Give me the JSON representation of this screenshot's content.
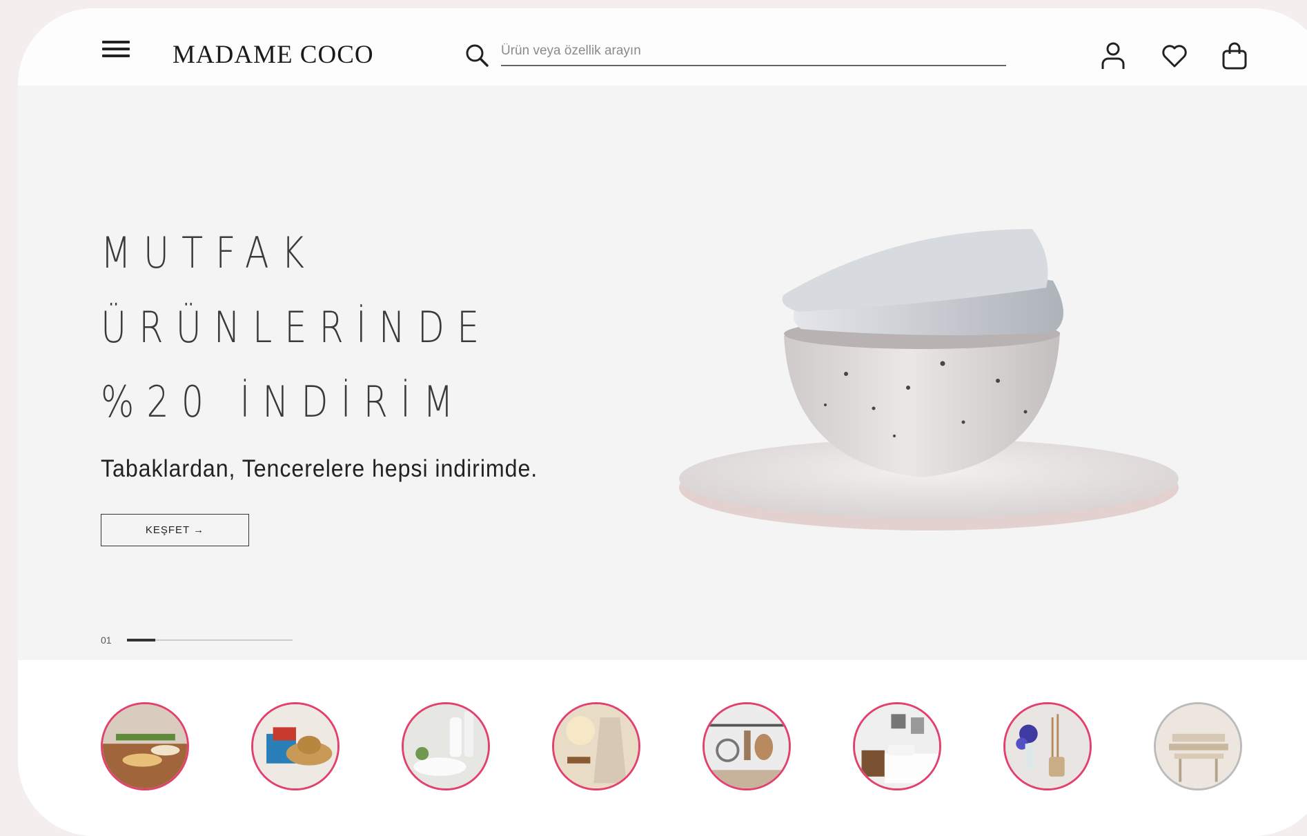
{
  "header": {
    "logo": "MADAME COCO",
    "search_placeholder": "Ürün veya özellik arayın",
    "icons": [
      "menu-icon",
      "search-icon",
      "user-icon",
      "heart-icon",
      "bag-icon"
    ]
  },
  "hero": {
    "title_lines": [
      "MUTFAK",
      "ÜRÜNLERİNDE",
      "%20 İNDİRİM"
    ],
    "subtitle": "Tabaklardan, Tencerelere hepsi indirimde.",
    "cta_label": "KEŞFET →",
    "slide_number": "01",
    "slide_progress": 0.17
  },
  "categories": [
    {
      "icon": "table-setting-image"
    },
    {
      "icon": "beach-hat-image"
    },
    {
      "icon": "bath-towels-image"
    },
    {
      "icon": "bathrobe-image"
    },
    {
      "icon": "kitchen-utensils-image"
    },
    {
      "icon": "bedroom-image"
    },
    {
      "icon": "decor-vase-image"
    },
    {
      "icon": "living-room-image"
    }
  ],
  "colors": {
    "accent_ring": "#e2416d",
    "background": "#f4f4f4",
    "text": "#222222"
  }
}
